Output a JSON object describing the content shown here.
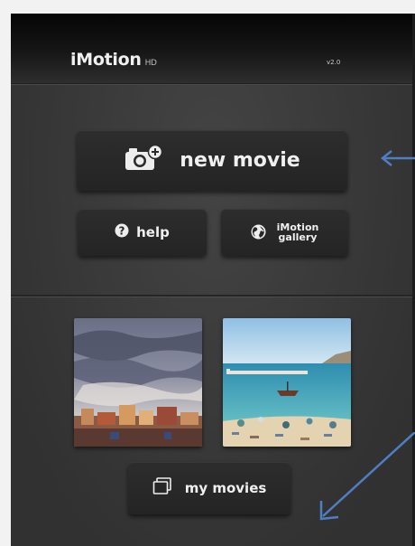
{
  "header": {
    "app_name": "iMotion",
    "app_suffix": "HD",
    "version": "v2.0"
  },
  "actions": {
    "new_movie_label": "new movie",
    "help_label": "help",
    "gallery_label_line1": "iMotion",
    "gallery_label_line2": "gallery",
    "my_movies_label": "my movies"
  },
  "thumbnails": [
    {
      "subject": "cloudy sky over rooftops"
    },
    {
      "subject": "beach and harbor with boats"
    }
  ],
  "colors": {
    "background": "#3a3a3a",
    "button": "#282828",
    "text": "#f0f0f0",
    "annotation_arrow": "#4f7fc1"
  },
  "icons": {
    "new_movie": "camera-plus-icon",
    "help": "question-circle-icon",
    "gallery": "globe-icon",
    "my_movies": "film-frames-icon"
  }
}
